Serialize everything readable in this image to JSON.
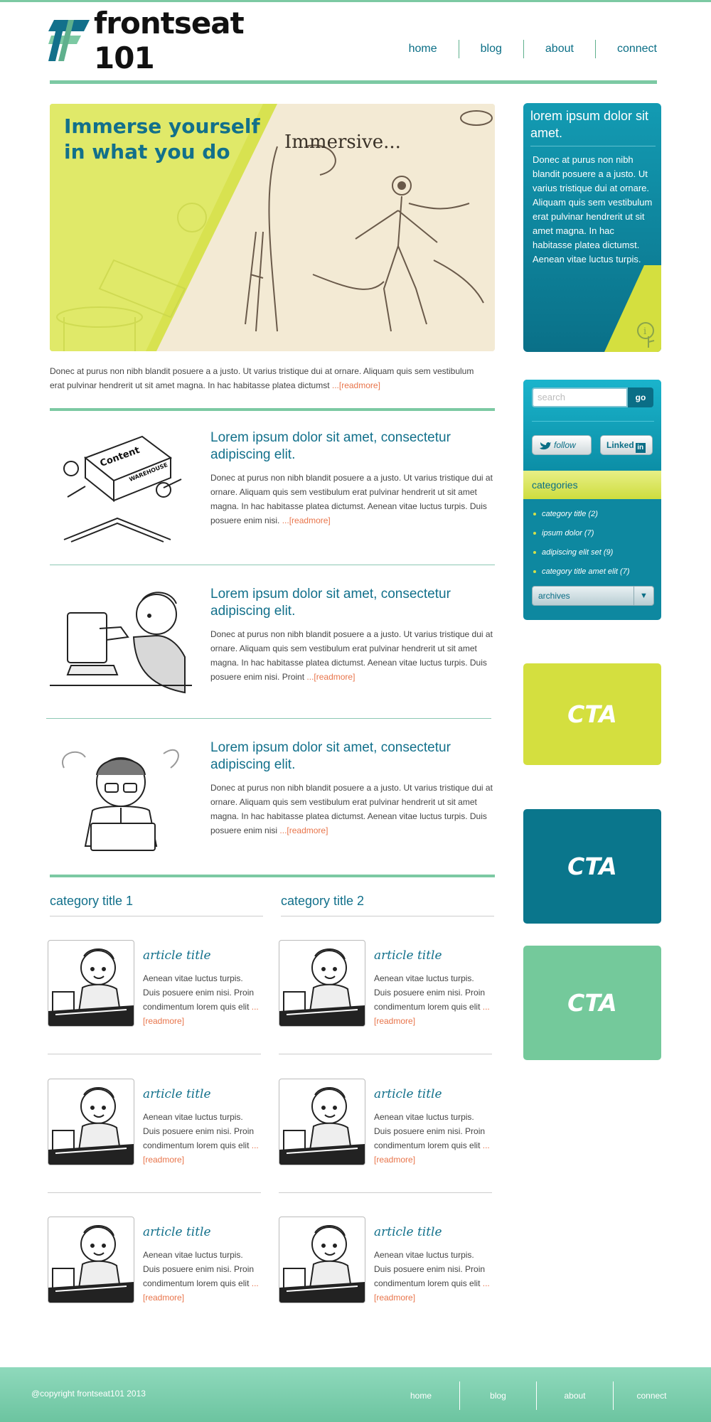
{
  "brand": {
    "name": "frontseat 101"
  },
  "nav": [
    {
      "label": "home"
    },
    {
      "label": "blog"
    },
    {
      "label": "about"
    },
    {
      "label": "connect"
    }
  ],
  "hero": {
    "title": "Immerse yourself in what you do",
    "sketch_caption": "Immersive..."
  },
  "intro": {
    "text": "Donec at purus non nibh blandit posuere a a justo. Ut varius tristique dui at ornare. Aliquam quis sem vestibulum erat pulvinar hendrerit ut sit amet magna. In hac habitasse platea dictumst",
    "readmore": " ...[readmore]"
  },
  "posts": [
    {
      "title": "Lorem ipsum dolor sit amet, consectetur adipiscing elit.",
      "body": "Donec at purus non nibh blandit posuere a a justo. Ut varius tristique dui at ornare. Aliquam quis sem vestibulum erat pulvinar hendrerit ut sit amet magna. In hac habitasse platea dictumst. Aenean vitae luctus turpis. Duis posuere enim nisi. ",
      "readmore": " ...[readmore]",
      "image_text": "Content",
      "image_subtext": "WAREHOUSE"
    },
    {
      "title": "Lorem ipsum dolor sit amet, consectetur adipiscing elit.",
      "body": "Donec at purus non nibh blandit posuere a a justo. Ut varius tristique dui at ornare. Aliquam quis sem vestibulum erat pulvinar hendrerit ut sit amet magna. In hac habitasse platea dictumst. Aenean vitae luctus turpis. Duis posuere enim nisi. Proint",
      "readmore": " ...[readmore]"
    },
    {
      "title": "Lorem ipsum dolor sit amet, consectetur adipiscing elit.",
      "body": "Donec at purus non nibh blandit posuere a a justo. Ut varius tristique dui at ornare. Aliquam quis sem vestibulum erat pulvinar hendrerit ut sit amet magna. In hac habitasse platea dictumst. Aenean vitae luctus turpis. Duis posuere enim nisi",
      "readmore": " ...[readmore]"
    }
  ],
  "categories_section": [
    {
      "title": "category title 1",
      "articles": [
        {
          "title": "article title",
          "body": "Aenean vitae luctus turpis. Duis posuere enim nisi. Proin condimentum lorem quis elit",
          "readmore": " ...[readmore]"
        },
        {
          "title": "article title",
          "body": "Aenean vitae luctus turpis. Duis posuere enim nisi. Proin condimentum lorem quis elit",
          "readmore": " ...[readmore]"
        },
        {
          "title": "article title",
          "body": "Aenean vitae luctus turpis. Duis posuere enim nisi. Proin condimentum lorem quis elit",
          "readmore": " ...[readmore]"
        }
      ]
    },
    {
      "title": "category title 2",
      "articles": [
        {
          "title": "article title",
          "body": "Aenean vitae luctus turpis. Duis posuere enim nisi. Proin condimentum lorem quis elit",
          "readmore": " ...[readmore]"
        },
        {
          "title": "article title",
          "body": "Aenean vitae luctus turpis. Duis posuere enim nisi. Proin condimentum lorem quis elit",
          "readmore": " ...[readmore]"
        },
        {
          "title": "article title",
          "body": "Aenean vitae luctus turpis. Duis posuere enim nisi. Proin condimentum lorem quis elit",
          "readmore": " ...[readmore]"
        }
      ]
    }
  ],
  "sidebar": {
    "info": {
      "title": "lorem ipsum dolor sit amet.",
      "body": "Donec at purus non nibh blandit posuere a a justo. Ut varius tristique dui at ornare. Aliquam quis sem vestibulum erat pulvinar hendrerit ut sit amet magna. In hac habitasse platea dictumst. Aenean vitae luctus turpis.",
      "icon": "info-icon"
    },
    "search": {
      "placeholder": "search",
      "button": "go"
    },
    "social": {
      "follow": "follow",
      "linkedin": "Linked",
      "linkedin_box": "in"
    },
    "categories": {
      "title": "categories",
      "items": [
        {
          "label": "category title (2)"
        },
        {
          "label": "ipsum dolor (7)"
        },
        {
          "label": "adipiscing elit set (9)"
        },
        {
          "label": "category title amet elit (7)"
        }
      ]
    },
    "archives": {
      "label": "archives"
    },
    "ctas": [
      {
        "label": "CTA",
        "color": "#d4df3f"
      },
      {
        "label": "CTA",
        "color": "#0a768c"
      },
      {
        "label": "CTA",
        "color": "#74c99b"
      }
    ]
  },
  "footer": {
    "copyright": "@copyright frontseat101 2013",
    "nav": [
      {
        "label": "home"
      },
      {
        "label": "blog"
      },
      {
        "label": "about"
      },
      {
        "label": "connect"
      }
    ]
  },
  "colors": {
    "accent_teal": "#12708b",
    "accent_green": "#7cc9a3",
    "accent_lime": "#d4df3f",
    "readmore": "#e8744a"
  }
}
